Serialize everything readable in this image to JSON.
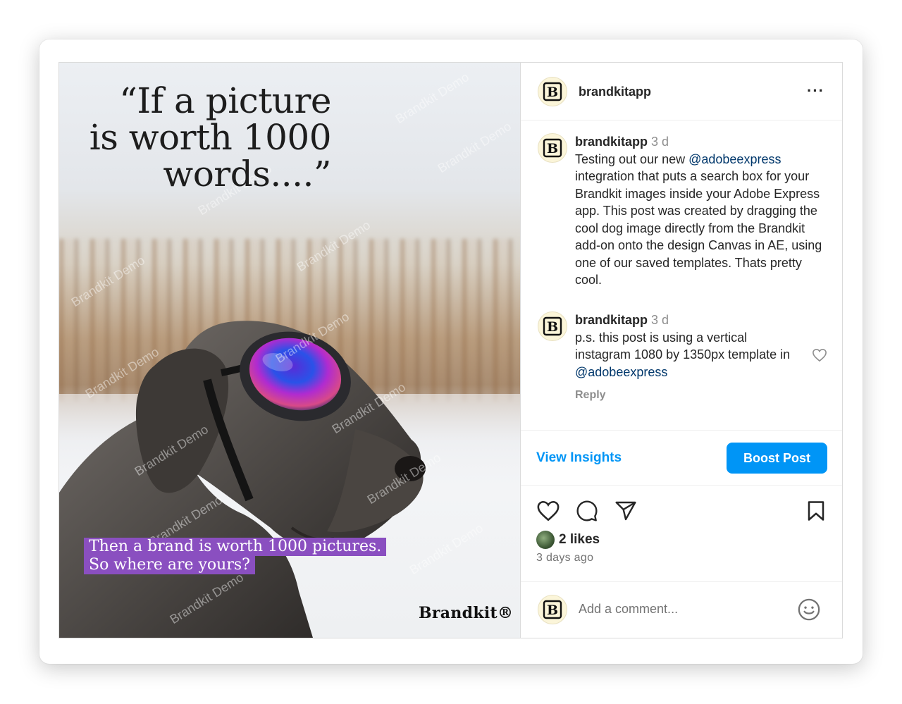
{
  "post": {
    "quote": "“If a picture is worth 1000 words....”",
    "tagline_line1": "Then a brand is worth 1000 pictures.",
    "tagline_line2": "So where are yours?",
    "brandmark": "Brandkit®",
    "watermark": "Brandkit Demo"
  },
  "header": {
    "username": "brandkitapp",
    "more_icon": "more-horizontal-icon"
  },
  "comments": [
    {
      "username": "brandkitapp",
      "time": "3 d",
      "text_before": "Testing out our new ",
      "mention": "@adobeexpress",
      "text_after": " integration that puts a search box for your Brandkit images inside your Adobe Express app. This post was created by dragging the cool dog image directly from the Brandkit add-on onto the design Canvas in AE, using one of our saved templates. Thats pretty cool."
    },
    {
      "username": "brandkitapp",
      "time": "3 d",
      "text_before": "p.s. this post is using a vertical instagram 1080 by 1350px template in ",
      "mention": "@adobeexpress",
      "text_after": "",
      "reply_label": "Reply"
    }
  ],
  "insights": {
    "view_label": "View Insights",
    "boost_label": "Boost Post"
  },
  "engagement": {
    "likes": "2 likes",
    "posted": "3 days ago"
  },
  "composer": {
    "placeholder": "Add a comment..."
  },
  "colors": {
    "accent": "#0095f6",
    "mention": "#00376b",
    "tagline_bg": "#8a4fc0"
  }
}
